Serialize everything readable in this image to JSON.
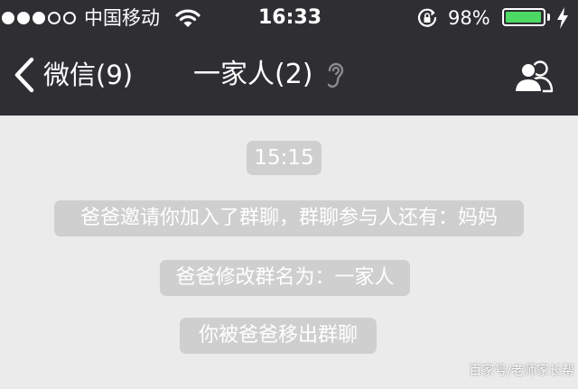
{
  "status_bar": {
    "signal_icon": "signal-dots-icon",
    "signal_strength": 3,
    "signal_max": 5,
    "carrier": "中国移动",
    "wifi_icon": "wifi-icon",
    "time": "16:33",
    "rotation_lock_icon": "rotation-lock-icon",
    "battery_percent_label": "98%",
    "battery_level": 98,
    "battery_color": "#4cd964",
    "charging_icon": "lightning-bolt-icon"
  },
  "nav_bar": {
    "background": "#2f2f33",
    "back_icon": "chevron-left-icon",
    "back_label": "微信(9)",
    "title": "一家人(2)",
    "earpiece_icon": "ear-icon",
    "members_icon": "group-members-icon"
  },
  "chat": {
    "background": "#ebebeb",
    "timestamp": "15:15",
    "system_messages": [
      "爸爸邀请你加入了群聊，群聊参与人还有：妈妈",
      "爸爸修改群名为：一家人",
      "你被爸爸移出群聊"
    ]
  },
  "watermark": "百家号/老师家长帮"
}
